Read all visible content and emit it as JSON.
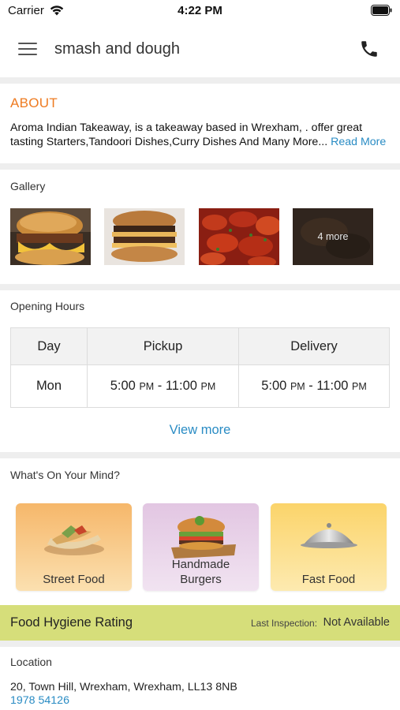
{
  "status_bar": {
    "carrier": "Carrier",
    "time": "4:22 PM"
  },
  "header": {
    "title": "smash and dough",
    "menu_icon": "hamburger-menu-icon",
    "call_icon": "phone-icon"
  },
  "about": {
    "title": "ABOUT",
    "text": "Aroma Indian Takeaway, is a takeaway based in Wrexham, . offer great tasting Starters,Tandoori Dishes,Curry Dishes And Many More...",
    "read_more": "Read More"
  },
  "gallery": {
    "title": "Gallery",
    "more_label": "4 more"
  },
  "opening_hours": {
    "title": "Opening Hours",
    "headers": [
      "Day",
      "Pickup",
      "Delivery"
    ],
    "rows": [
      {
        "day": "Mon",
        "pickup": {
          "open": "5:00",
          "open_ampm": "PM",
          "sep": " - ",
          "close": "11:00",
          "close_ampm": "PM"
        },
        "delivery": {
          "open": "5:00",
          "open_ampm": "PM",
          "sep": " - ",
          "close": "11:00",
          "close_ampm": "PM"
        }
      }
    ],
    "view_more": "View more"
  },
  "categories": {
    "title": "What's On Your Mind?",
    "items": [
      {
        "label": "Street Food",
        "icon": "wrap-food-icon"
      },
      {
        "label": "Handmade Burgers",
        "icon": "burger-icon"
      },
      {
        "label": "Fast Food",
        "icon": "cloche-icon"
      }
    ]
  },
  "hygiene": {
    "title": "Food Hygiene Rating",
    "inspection_label": "Last Inspection:",
    "inspection_value": "Not Available",
    "bar_color": "#d6de7a"
  },
  "location": {
    "title": "Location",
    "address": "20, Town Hill, Wrexham, Wrexham, LL13 8NB",
    "phone": "1978 54126"
  },
  "colors": {
    "accent_orange": "#ee7b21",
    "link_blue": "#2a8cc4"
  }
}
